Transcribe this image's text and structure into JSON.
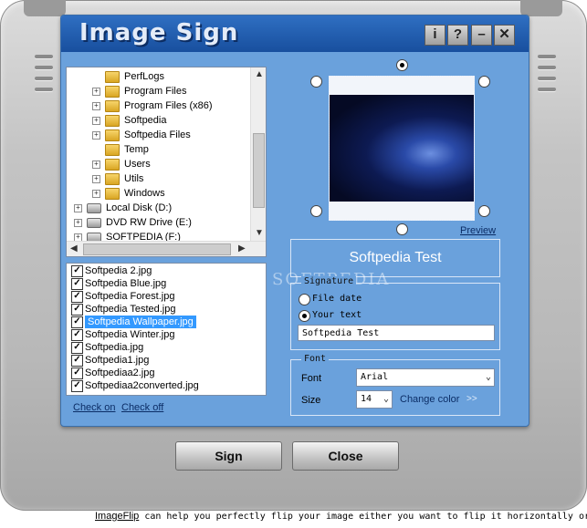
{
  "app": {
    "title": "Image Sign",
    "buttons": {
      "info": "i",
      "help": "?",
      "minimize": "–",
      "close": "✕"
    }
  },
  "tree": {
    "items": [
      {
        "label": "PerfLogs",
        "type": "folder",
        "expandable": false
      },
      {
        "label": "Program Files",
        "type": "folder",
        "expandable": true
      },
      {
        "label": "Program Files (x86)",
        "type": "folder",
        "expandable": true
      },
      {
        "label": "Softpedia",
        "type": "folder",
        "expandable": true
      },
      {
        "label": "Softpedia Files",
        "type": "folder",
        "expandable": true
      },
      {
        "label": "Temp",
        "type": "folder",
        "expandable": false
      },
      {
        "label": "Users",
        "type": "folder",
        "expandable": true
      },
      {
        "label": "Utils",
        "type": "folder",
        "expandable": true
      },
      {
        "label": "Windows",
        "type": "folder",
        "expandable": true
      },
      {
        "label": "Local Disk (D:)",
        "type": "drive",
        "expandable": true
      },
      {
        "label": "DVD RW Drive (E:)",
        "type": "drive",
        "expandable": true
      },
      {
        "label": "SOFTPEDIA (F:)",
        "type": "drive",
        "expandable": true
      }
    ]
  },
  "files": {
    "items": [
      {
        "label": "Softpedia 2.jpg",
        "checked": true,
        "selected": false
      },
      {
        "label": "Softpedia Blue.jpg",
        "checked": true,
        "selected": false
      },
      {
        "label": "Softpedia Forest.jpg",
        "checked": true,
        "selected": false
      },
      {
        "label": "Softpedia Tested.jpg",
        "checked": true,
        "selected": false
      },
      {
        "label": "Softpedia Wallpaper.jpg",
        "checked": true,
        "selected": true
      },
      {
        "label": "Softpedia Winter.jpg",
        "checked": true,
        "selected": false
      },
      {
        "label": "Softpedia.jpg",
        "checked": true,
        "selected": false
      },
      {
        "label": "Softpedia1.jpg",
        "checked": true,
        "selected": false
      },
      {
        "label": "Softpediaa2.jpg",
        "checked": true,
        "selected": false
      },
      {
        "label": "Softpediaa2converted.jpg",
        "checked": true,
        "selected": false
      }
    ],
    "check_on": "Check on",
    "check_off": "Check off"
  },
  "preview": {
    "link": "Preview",
    "watermark": "SOFTPEDIA"
  },
  "signature": {
    "display": "Softpedia Test",
    "group_label": "Signature",
    "option_file_date": "File date",
    "option_your_text": "Your text",
    "text_value": "Softpedia Test"
  },
  "font": {
    "group_label": "Font",
    "font_label": "Font",
    "font_value": "Arial",
    "size_label": "Size",
    "size_value": "14",
    "change_color": "Change color",
    "change_color_arrow": ">>"
  },
  "actions": {
    "sign": "Sign",
    "close": "Close"
  },
  "ticker": {
    "link": "ImageFlip",
    "text": " can help you perfectly flip your image either you want to flip it horizontally or"
  },
  "colors": {
    "panel": "#6aa1dc",
    "titlebar": "#184f9e",
    "selection": "#3399ff"
  }
}
